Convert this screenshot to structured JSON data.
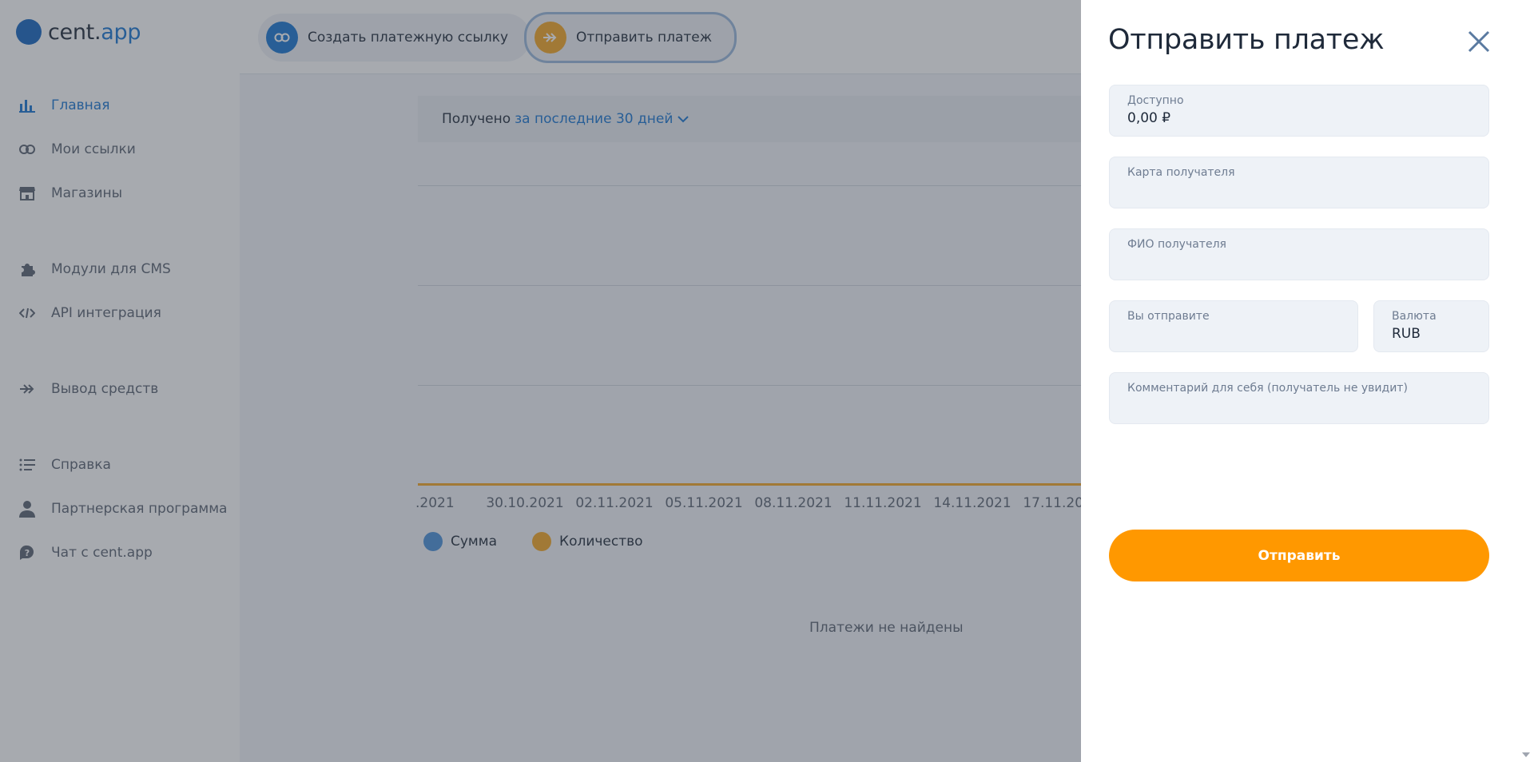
{
  "app": {
    "logo_text_main": "cent.",
    "logo_text_accent": "app"
  },
  "sidebar": {
    "items": [
      {
        "label": "Главная",
        "icon": "bar-chart-icon",
        "active": true
      },
      {
        "label": "Мои ссылки",
        "icon": "link-icon"
      },
      {
        "label": "Магазины",
        "icon": "store-icon"
      },
      {
        "label": "Модули для CMS",
        "icon": "puzzle-icon"
      },
      {
        "label": "API интеграция",
        "icon": "code-icon"
      },
      {
        "label": "Вывод средств",
        "icon": "double-arrow-icon"
      },
      {
        "label": "Справка",
        "icon": "list-icon"
      },
      {
        "label": "Партнерская программа",
        "icon": "user-icon"
      },
      {
        "label": "Чат с cent.app",
        "icon": "chat-question-icon"
      }
    ]
  },
  "toolbar": {
    "create_link_label": "Создать платежную ссылку",
    "send_payment_label": "Отправить платеж"
  },
  "main": {
    "received_label": "Получено",
    "period_label": "за последние 30 дней",
    "ticks": [
      ".2021",
      "30.10.2021",
      "02.11.2021",
      "05.11.2021",
      "08.11.2021",
      "11.11.2021",
      "14.11.2021",
      "17.11.2021"
    ],
    "legend": {
      "sum": "Сумма",
      "count": "Количество"
    },
    "empty_message": "Платежи не найдены"
  },
  "chart_data": {
    "type": "line",
    "x": [
      ".2021",
      "30.10.2021",
      "02.11.2021",
      "05.11.2021",
      "08.11.2021",
      "11.11.2021",
      "14.11.2021",
      "17.11.2021"
    ],
    "series": [
      {
        "name": "Сумма",
        "values": [
          0,
          0,
          0,
          0,
          0,
          0,
          0,
          0
        ]
      },
      {
        "name": "Количество",
        "values": [
          0,
          0,
          0,
          0,
          0,
          0,
          0,
          0
        ]
      }
    ],
    "legend": "bottom-left",
    "grid": true
  },
  "drawer": {
    "title": "Отправить платеж",
    "available_label": "Доступно",
    "available_value": "0,00 ₽",
    "card_label": "Карта получателя",
    "card_value": "",
    "name_label": "ФИО получателя",
    "name_value": "",
    "amount_label": "Вы отправите",
    "amount_value": "",
    "currency_label": "Валюта",
    "currency_value": "RUB",
    "comment_label": "Комментарий для себя (получатель не увидит)",
    "comment_value": "",
    "submit_label": "Отправить"
  },
  "colors": {
    "primary": "#1976d2",
    "accent": "#ff9800",
    "sum_series": "#4a90d9",
    "count_series": "#f5a623"
  }
}
